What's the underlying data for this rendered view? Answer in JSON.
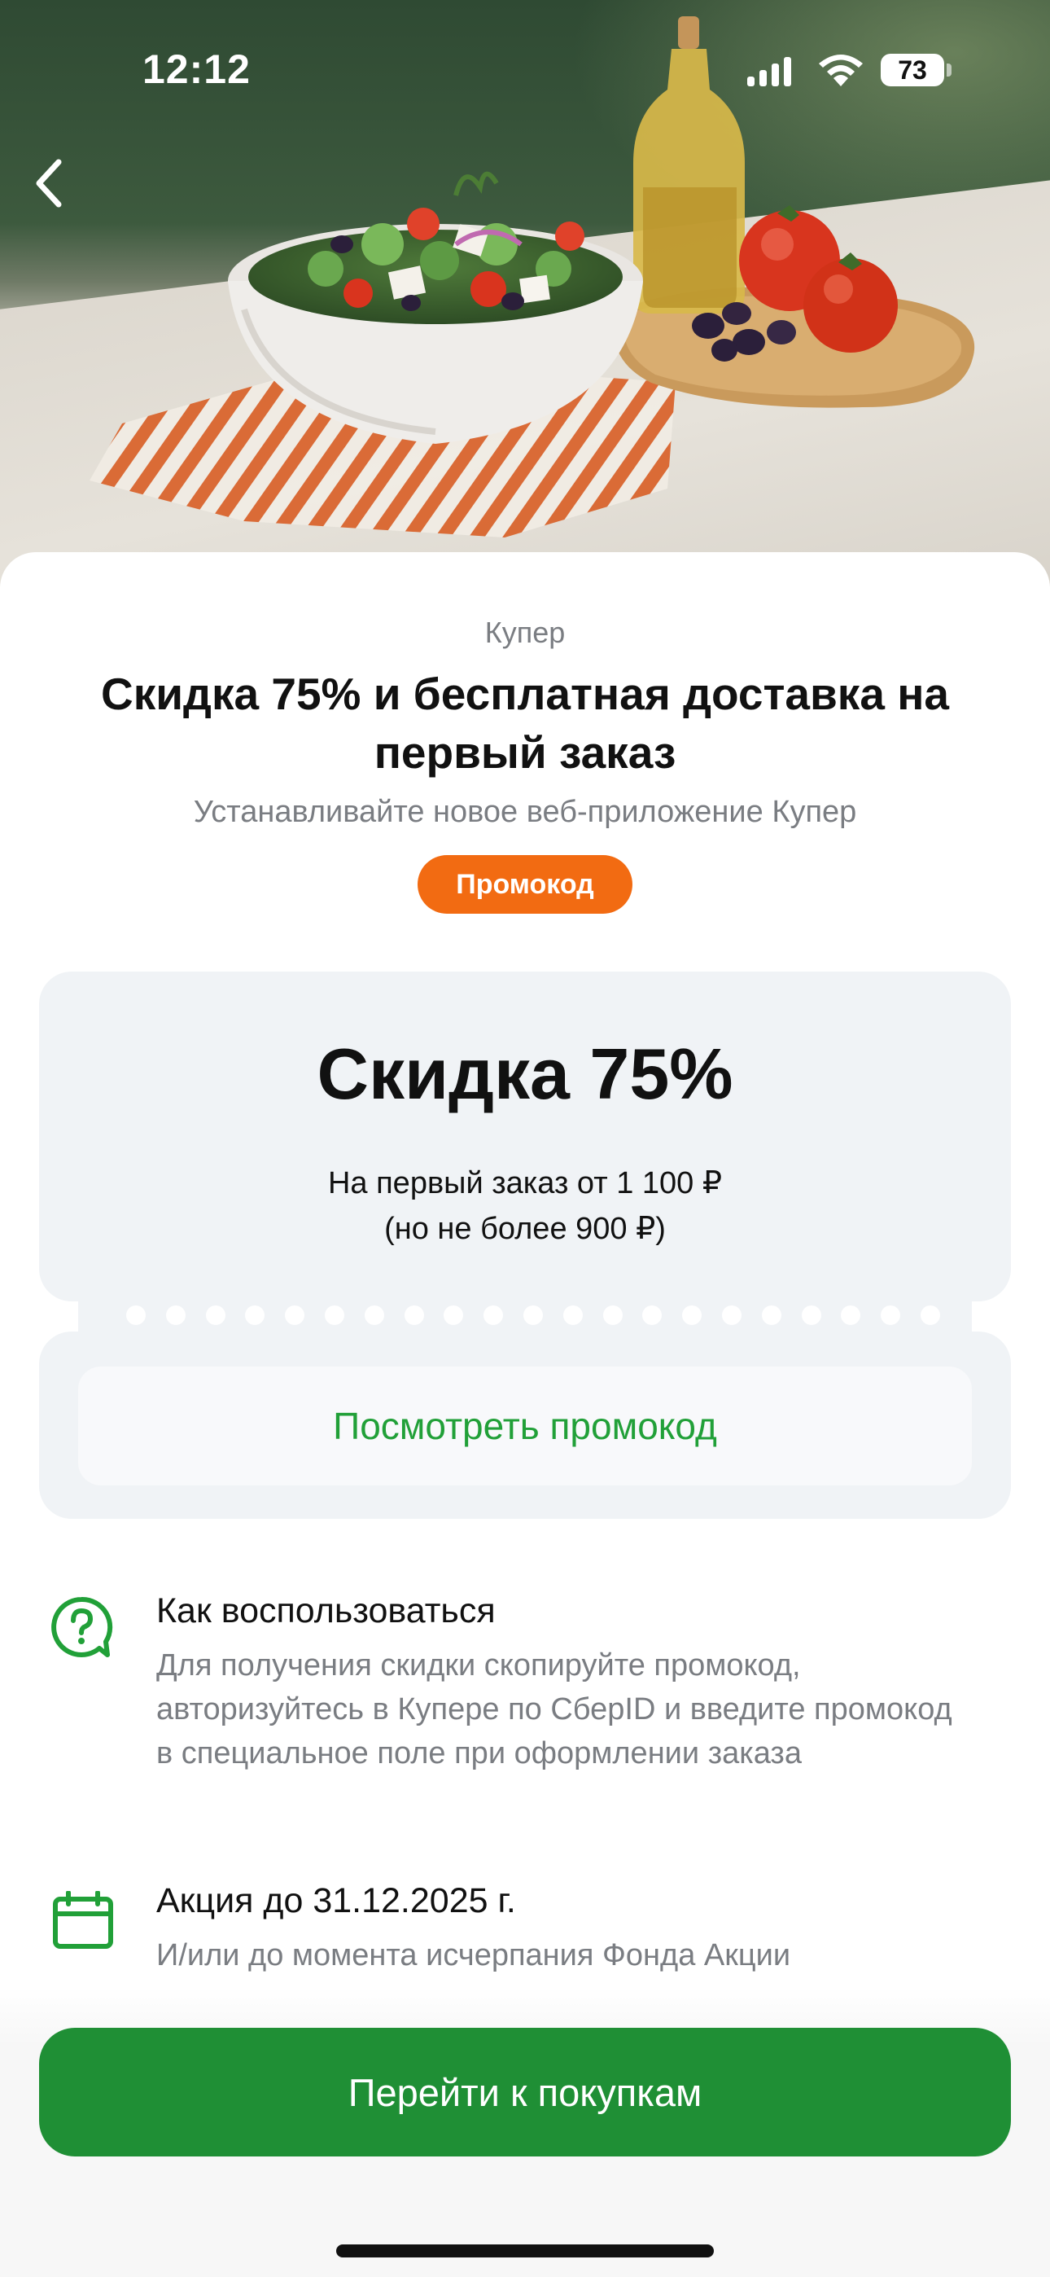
{
  "status_bar": {
    "time": "12:12",
    "battery": "73"
  },
  "nav": {
    "back_icon": "chevron-left-icon"
  },
  "hero": {
    "image": "greek-salad-bowl-with-olive-oil-and-tomatoes"
  },
  "offer": {
    "brand": "Купер",
    "title": "Скидка 75% и бесплатная доставка на первый заказ",
    "subtitle": "Устанавливайте новое веб-приложение Купер",
    "badge": "Промокод",
    "badge_color": "#f26b12"
  },
  "coupon": {
    "discount": "Скидка 75%",
    "condition_line1": "На первый заказ от 1 100 ₽",
    "condition_line2": "(но не более 900 ₽)",
    "view_promo_label": "Посмотреть промокод"
  },
  "info": [
    {
      "icon": "question-chat-icon",
      "title": "Как воспользоваться",
      "text": "Для получения скидки скопируйте промокод, авторизуйтесь в Купере по СберID и введите промокод в специальное поле при оформлении заказа"
    },
    {
      "icon": "calendar-icon",
      "title": "Акция до 31.12.2025 г.",
      "text": "И/или до момента исчерпания Фонда Акции"
    }
  ],
  "cta": {
    "label": "Перейти к покупкам",
    "color": "#1f8f35"
  },
  "accent_color": "#21a038"
}
